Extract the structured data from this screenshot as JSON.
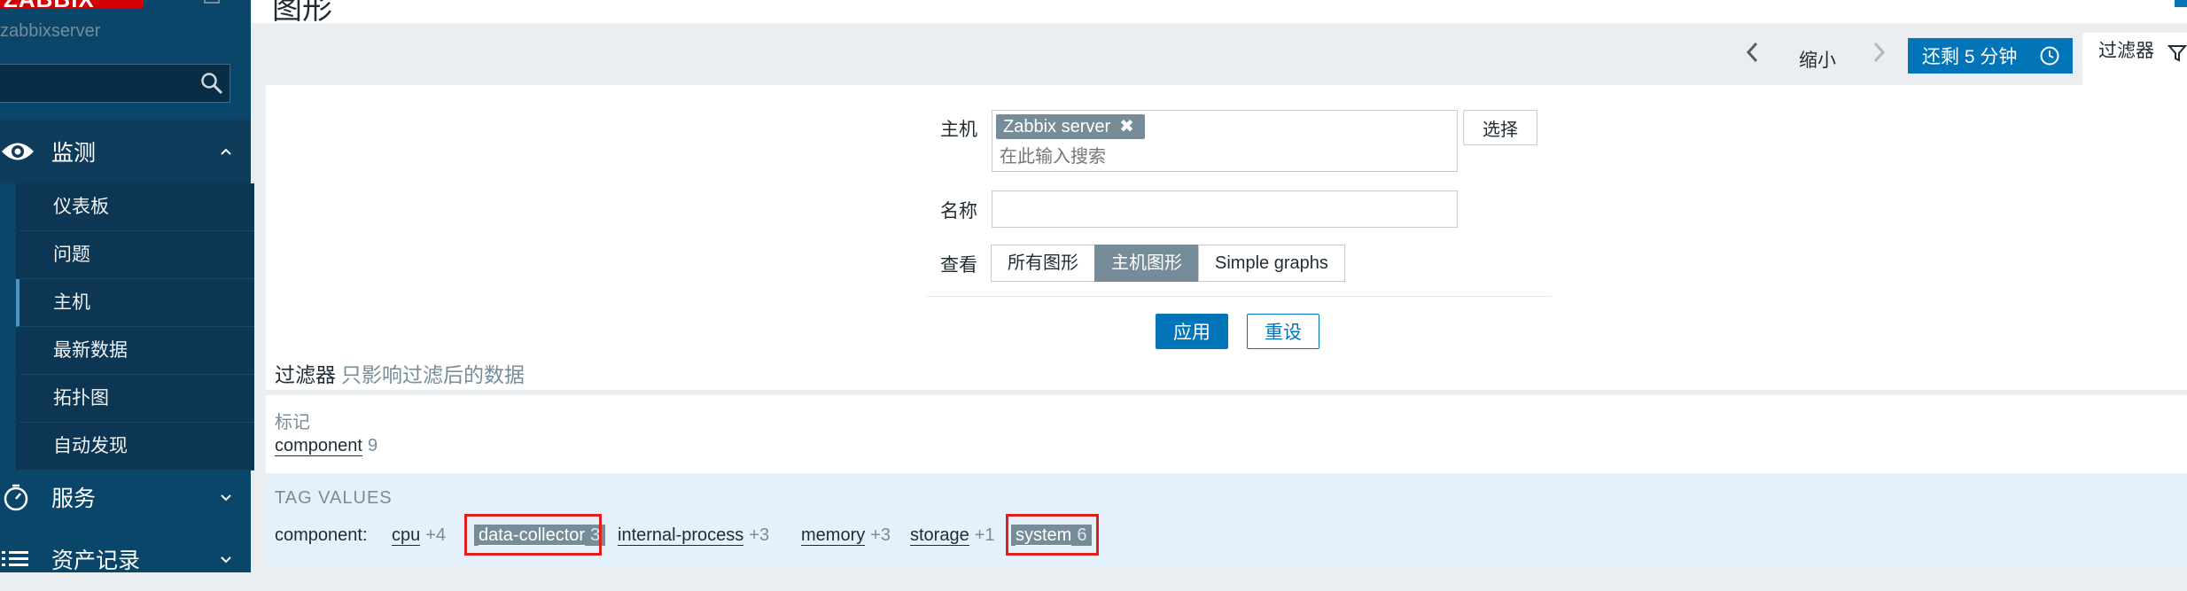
{
  "sidebar": {
    "logo_text": "ZABBIX",
    "server_name": "zabbixserver",
    "search": {
      "value": "",
      "placeholder": ""
    },
    "sections": {
      "monitoring": {
        "label": "监测",
        "icon": "eye-icon",
        "expanded": true
      },
      "services": {
        "label": "服务",
        "icon": "stopwatch-icon"
      },
      "inventory": {
        "label": "资产记录",
        "icon": "list-icon"
      }
    },
    "monitoring_items": [
      {
        "label": "仪表板"
      },
      {
        "label": "问题"
      },
      {
        "label": "主机",
        "active": true
      },
      {
        "label": "最新数据"
      },
      {
        "label": "拓扑图"
      },
      {
        "label": "自动发现"
      }
    ]
  },
  "header": {
    "title": "图形"
  },
  "timebar": {
    "zoom_out_label": "缩小",
    "range_label": "还剩 5 分钟",
    "filter_tab_label": "过滤器"
  },
  "filter": {
    "host_label": "主机",
    "host_selected": "Zabbix server",
    "host_search_placeholder": "在此输入搜索",
    "select_button": "选择",
    "name_label": "名称",
    "name_value": "",
    "view_label": "查看",
    "view_options": [
      "所有图形",
      "主机图形",
      "Simple graphs"
    ],
    "view_selected": "主机图形",
    "apply_button": "应用",
    "reset_button": "重设",
    "title": "过滤器",
    "subtitle": "只影响过滤后的数据"
  },
  "tags": {
    "heading": "标记",
    "items": [
      {
        "name": "component",
        "count": "9"
      }
    ]
  },
  "tag_values": {
    "heading": "TAG VALUES",
    "key_label": "component:",
    "items": [
      {
        "value": "cpu",
        "count": "+4",
        "selected": false
      },
      {
        "value": "data-collector",
        "count": "3",
        "selected": true
      },
      {
        "value": "internal-process",
        "count": "+3",
        "selected": false
      },
      {
        "value": "memory",
        "count": "+3",
        "selected": false
      },
      {
        "value": "storage",
        "count": "+1",
        "selected": false
      },
      {
        "value": "system",
        "count": "6",
        "selected": true
      }
    ]
  },
  "colors": {
    "sidebar_bg": "#0a466a",
    "accent": "#0275b8",
    "selected_tag_bg": "#768d99",
    "highlight": "#e02020",
    "tag_values_bg": "#e5f1fa"
  }
}
